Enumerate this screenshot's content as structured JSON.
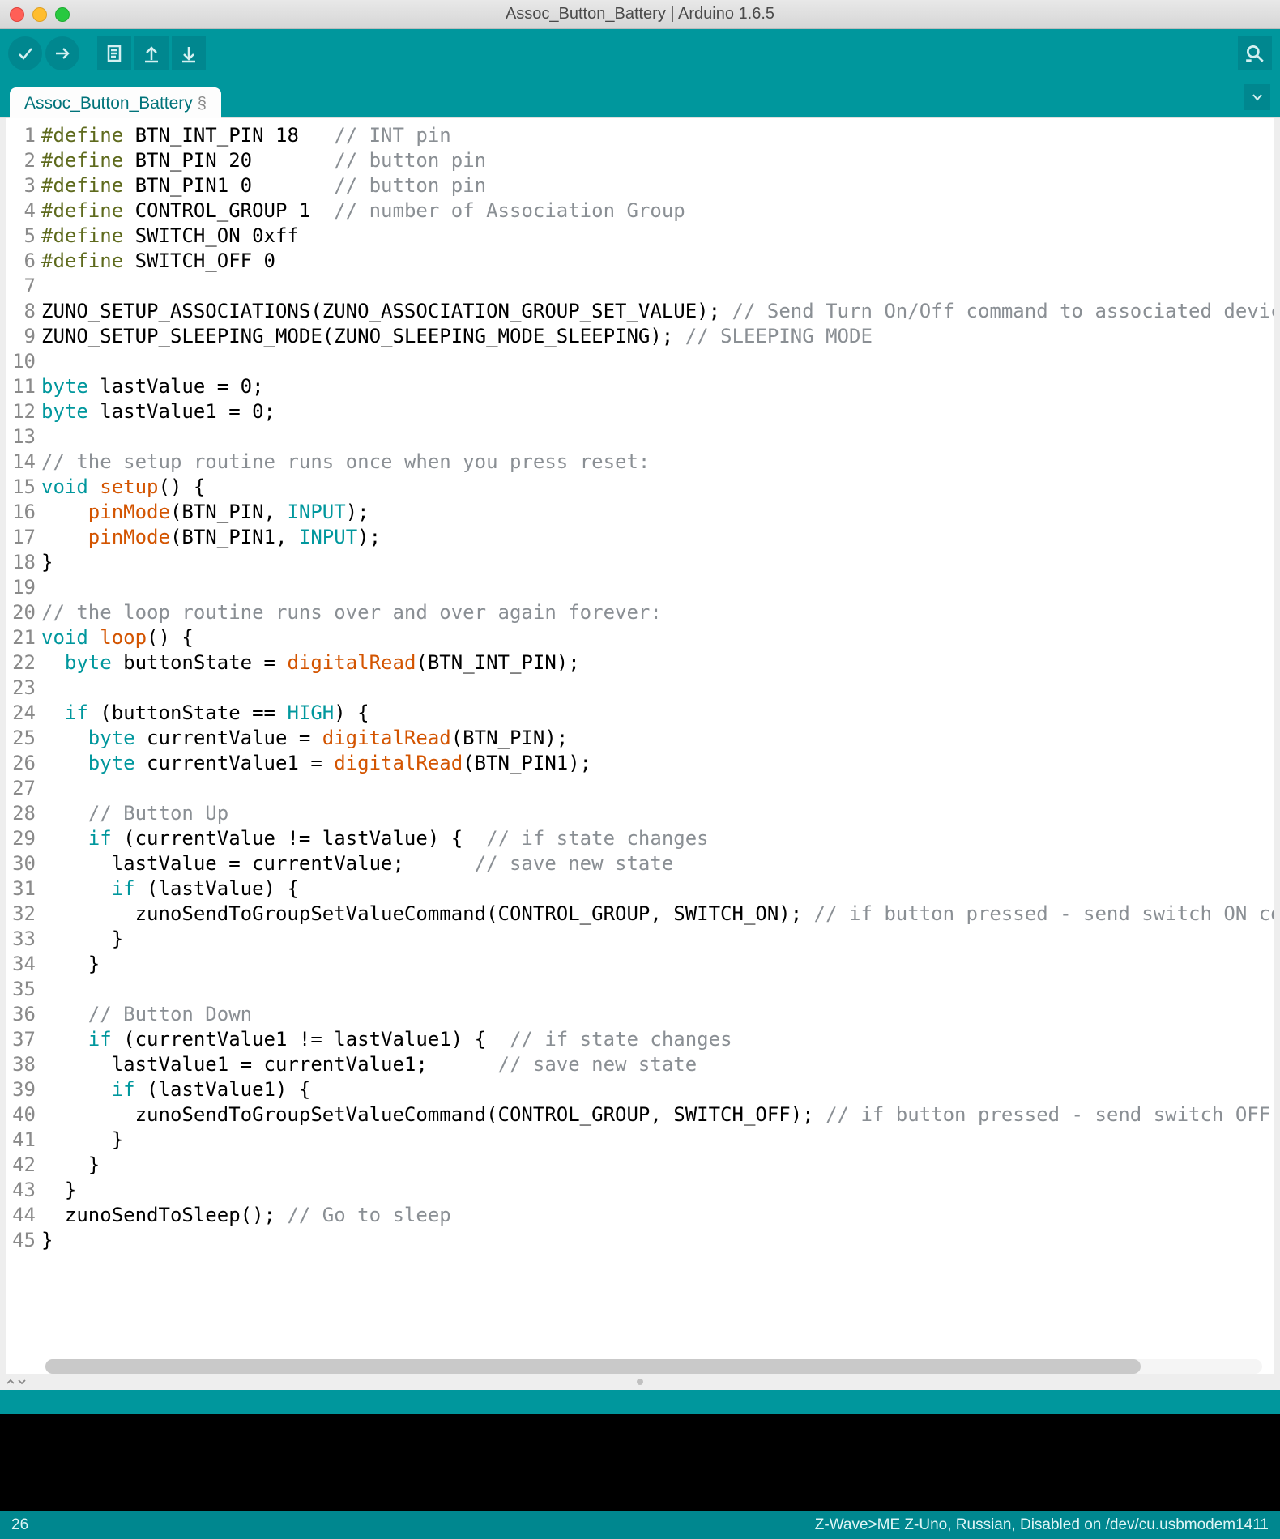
{
  "window": {
    "title": "Assoc_Button_Battery | Arduino 1.6.5"
  },
  "toolbar": {
    "verify": "Verify",
    "upload": "Upload",
    "new": "New",
    "open": "Open",
    "save": "Save",
    "serial": "Serial Monitor"
  },
  "tabs": {
    "active": "Assoc_Button_Battery",
    "dirty": "§"
  },
  "status": {
    "left": "26",
    "right": "Z-Wave>ME Z-Uno, Russian, Disabled on /dev/cu.usbmodem1411"
  },
  "code": {
    "lines": [
      [
        [
          "d",
          "#define"
        ],
        [
          "p",
          " BTN_INT_PIN 18   "
        ],
        [
          "c",
          "// INT pin"
        ]
      ],
      [
        [
          "d",
          "#define"
        ],
        [
          "p",
          " BTN_PIN 20       "
        ],
        [
          "c",
          "// button pin"
        ]
      ],
      [
        [
          "d",
          "#define"
        ],
        [
          "p",
          " BTN_PIN1 0       "
        ],
        [
          "c",
          "// button pin"
        ]
      ],
      [
        [
          "d",
          "#define"
        ],
        [
          "p",
          " CONTROL_GROUP 1  "
        ],
        [
          "c",
          "// number of Association Group"
        ]
      ],
      [
        [
          "d",
          "#define"
        ],
        [
          "p",
          " SWITCH_ON 0xff"
        ]
      ],
      [
        [
          "d",
          "#define"
        ],
        [
          "p",
          " SWITCH_OFF 0"
        ]
      ],
      [
        [
          "p",
          ""
        ]
      ],
      [
        [
          "p",
          "ZUNO_SETUP_ASSOCIATIONS(ZUNO_ASSOCIATION_GROUP_SET_VALUE); "
        ],
        [
          "c",
          "// Send Turn On/Off command to associated devices"
        ]
      ],
      [
        [
          "p",
          "ZUNO_SETUP_SLEEPING_MODE(ZUNO_SLEEPING_MODE_SLEEPING); "
        ],
        [
          "c",
          "// SLEEPING MODE"
        ]
      ],
      [
        [
          "p",
          ""
        ]
      ],
      [
        [
          "k",
          "byte"
        ],
        [
          "p",
          " lastValue = 0;"
        ]
      ],
      [
        [
          "k",
          "byte"
        ],
        [
          "p",
          " lastValue1 = 0;"
        ]
      ],
      [
        [
          "p",
          ""
        ]
      ],
      [
        [
          "c",
          "// the setup routine runs once when you press reset:"
        ]
      ],
      [
        [
          "k",
          "void"
        ],
        [
          "p",
          " "
        ],
        [
          "f",
          "setup"
        ],
        [
          "p",
          "() {"
        ]
      ],
      [
        [
          "p",
          "    "
        ],
        [
          "f",
          "pinMode"
        ],
        [
          "p",
          "(BTN_PIN, "
        ],
        [
          "k",
          "INPUT"
        ],
        [
          "p",
          ");"
        ]
      ],
      [
        [
          "p",
          "    "
        ],
        [
          "f",
          "pinMode"
        ],
        [
          "p",
          "(BTN_PIN1, "
        ],
        [
          "k",
          "INPUT"
        ],
        [
          "p",
          ");"
        ]
      ],
      [
        [
          "p",
          "}"
        ]
      ],
      [
        [
          "p",
          ""
        ]
      ],
      [
        [
          "c",
          "// the loop routine runs over and over again forever:"
        ]
      ],
      [
        [
          "k",
          "void"
        ],
        [
          "p",
          " "
        ],
        [
          "f",
          "loop"
        ],
        [
          "p",
          "() {"
        ]
      ],
      [
        [
          "p",
          "  "
        ],
        [
          "k",
          "byte"
        ],
        [
          "p",
          " buttonState = "
        ],
        [
          "f",
          "digitalRead"
        ],
        [
          "p",
          "(BTN_INT_PIN);"
        ]
      ],
      [
        [
          "p",
          ""
        ]
      ],
      [
        [
          "p",
          "  "
        ],
        [
          "k",
          "if"
        ],
        [
          "p",
          " (buttonState == "
        ],
        [
          "k",
          "HIGH"
        ],
        [
          "p",
          ") {"
        ]
      ],
      [
        [
          "p",
          "    "
        ],
        [
          "k",
          "byte"
        ],
        [
          "p",
          " currentValue = "
        ],
        [
          "f",
          "digitalRead"
        ],
        [
          "p",
          "(BTN_PIN);"
        ]
      ],
      [
        [
          "p",
          "    "
        ],
        [
          "k",
          "byte"
        ],
        [
          "p",
          " currentValue1 = "
        ],
        [
          "f",
          "digitalRead"
        ],
        [
          "p",
          "(BTN_PIN1);"
        ]
      ],
      [
        [
          "p",
          ""
        ]
      ],
      [
        [
          "p",
          "    "
        ],
        [
          "c",
          "// Button Up"
        ]
      ],
      [
        [
          "p",
          "    "
        ],
        [
          "k",
          "if"
        ],
        [
          "p",
          " (currentValue != lastValue) {  "
        ],
        [
          "c",
          "// if state changes"
        ]
      ],
      [
        [
          "p",
          "      lastValue = currentValue;      "
        ],
        [
          "c",
          "// save new state"
        ]
      ],
      [
        [
          "p",
          "      "
        ],
        [
          "k",
          "if"
        ],
        [
          "p",
          " (lastValue) {"
        ]
      ],
      [
        [
          "p",
          "        zunoSendToGroupSetValueCommand(CONTROL_GROUP, SWITCH_ON); "
        ],
        [
          "c",
          "// if button pressed - send switch ON command"
        ]
      ],
      [
        [
          "p",
          "      }"
        ]
      ],
      [
        [
          "p",
          "    }"
        ]
      ],
      [
        [
          "p",
          ""
        ]
      ],
      [
        [
          "p",
          "    "
        ],
        [
          "c",
          "// Button Down"
        ]
      ],
      [
        [
          "p",
          "    "
        ],
        [
          "k",
          "if"
        ],
        [
          "p",
          " (currentValue1 != lastValue1) {  "
        ],
        [
          "c",
          "// if state changes"
        ]
      ],
      [
        [
          "p",
          "      lastValue1 = currentValue1;      "
        ],
        [
          "c",
          "// save new state"
        ]
      ],
      [
        [
          "p",
          "      "
        ],
        [
          "k",
          "if"
        ],
        [
          "p",
          " (lastValue1) {"
        ]
      ],
      [
        [
          "p",
          "        zunoSendToGroupSetValueCommand(CONTROL_GROUP, SWITCH_OFF); "
        ],
        [
          "c",
          "// if button pressed - send switch OFF command"
        ]
      ],
      [
        [
          "p",
          "      }"
        ]
      ],
      [
        [
          "p",
          "    }"
        ]
      ],
      [
        [
          "p",
          "  }"
        ]
      ],
      [
        [
          "p",
          "  zunoSendToSleep(); "
        ],
        [
          "c",
          "// Go to sleep"
        ]
      ],
      [
        [
          "p",
          "}"
        ]
      ]
    ]
  }
}
